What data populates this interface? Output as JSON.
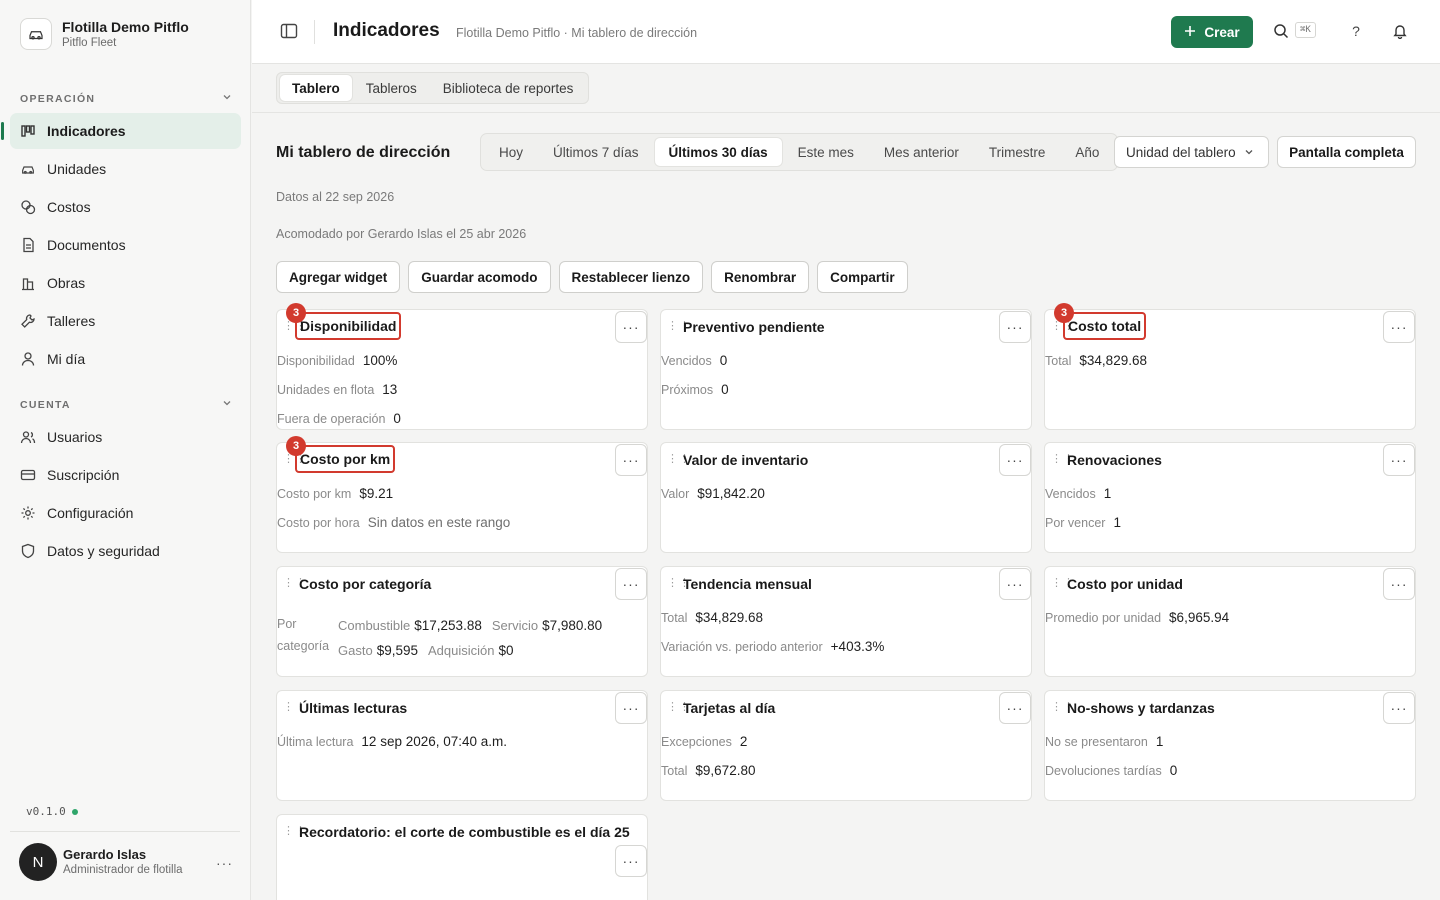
{
  "org": {
    "name": "Flotilla Demo Pitflo",
    "sub": "Pitflo Fleet"
  },
  "sidebar": {
    "section_operation": "OPERACIÓN",
    "section_account": "CUENTA",
    "items": [
      {
        "label": "Indicadores",
        "icon": "bar-chart-icon"
      },
      {
        "label": "Unidades",
        "icon": "car-icon"
      },
      {
        "label": "Costos",
        "icon": "coins-icon"
      },
      {
        "label": "Documentos",
        "icon": "document-icon"
      },
      {
        "label": "Obras",
        "icon": "building-icon"
      },
      {
        "label": "Talleres",
        "icon": "wrench-icon"
      },
      {
        "label": "Mi día",
        "icon": "person-icon"
      }
    ],
    "account_items": [
      {
        "label": "Usuarios",
        "icon": "users-icon"
      },
      {
        "label": "Suscripción",
        "icon": "credit-card-icon"
      },
      {
        "label": "Configuración",
        "icon": "gear-icon"
      },
      {
        "label": "Datos y seguridad",
        "icon": "shield-icon"
      }
    ],
    "version": "v0.1.0"
  },
  "user": {
    "initial": "N",
    "name": "Gerardo Islas",
    "role": "Administrador de flotilla",
    "more": "···"
  },
  "topbar": {
    "title": "Indicadores",
    "breadcrumb": "Flotilla Demo Pitflo · Mi tablero de dirección",
    "create_label": "Crear",
    "shortcut": "⌘K",
    "help": "?"
  },
  "tabs": [
    "Tablero",
    "Tableros",
    "Biblioteca de reportes"
  ],
  "dashboard": {
    "title": "Mi tablero de dirección",
    "ranges": [
      "Hoy",
      "Últimos 7 días",
      "Últimos 30 días",
      "Este mes",
      "Mes anterior",
      "Trimestre",
      "Año"
    ],
    "active_range": "Últimos 30 días",
    "unit_select": "Unidad del tablero",
    "fullscreen": "Pantalla completa",
    "data_as_of": "Datos al 22 sep 2026",
    "arranged_by": "Acomodado por Gerardo Islas el 25 abr 2026",
    "actions": [
      "Agregar widget",
      "Guardar acomodo",
      "Restablecer lienzo",
      "Renombrar",
      "Compartir"
    ]
  },
  "widgets": {
    "availability": {
      "title": "Disponibilidad",
      "badge": "3",
      "rows": [
        {
          "label": "Disponibilidad",
          "value": "100%"
        },
        {
          "label": "Unidades en flota",
          "value": "13"
        },
        {
          "label": "Fuera de operación",
          "value": "0"
        }
      ]
    },
    "preventive": {
      "title": "Preventivo pendiente",
      "rows": [
        {
          "label": "Vencidos",
          "value": "0"
        },
        {
          "label": "Próximos",
          "value": "0"
        }
      ]
    },
    "total_cost": {
      "title": "Costo total",
      "badge": "3",
      "rows": [
        {
          "label": "Total",
          "value": "$34,829.68"
        }
      ]
    },
    "cost_km": {
      "title": "Costo por km",
      "badge": "3",
      "rows": [
        {
          "label": "Costo por km",
          "value": "$9.21"
        },
        {
          "label": "Costo por hora",
          "value": "Sin datos en este rango"
        }
      ]
    },
    "inventory": {
      "title": "Valor de inventario",
      "rows": [
        {
          "label": "Valor",
          "value": "$91,842.20"
        }
      ]
    },
    "renewals": {
      "title": "Renovaciones",
      "rows": [
        {
          "label": "Vencidos",
          "value": "1"
        },
        {
          "label": "Por vencer",
          "value": "1"
        }
      ]
    },
    "by_category": {
      "title": "Costo por categoría",
      "label": "Por categoría",
      "items": [
        {
          "label": "Combustible",
          "value": "$17,253.88"
        },
        {
          "label": "Servicio",
          "value": "$7,980.80"
        },
        {
          "label": "Gasto",
          "value": "$9,595"
        },
        {
          "label": "Adquisición",
          "value": "$0"
        }
      ]
    },
    "trend": {
      "title": "Tendencia mensual",
      "rows": [
        {
          "label": "Total",
          "value": "$34,829.68"
        },
        {
          "label": "Variación vs. periodo anterior",
          "value": "+403.3%"
        }
      ]
    },
    "per_unit": {
      "title": "Costo por unidad",
      "rows": [
        {
          "label": "Promedio por unidad",
          "value": "$6,965.94"
        }
      ]
    },
    "readings": {
      "title": "Últimas lecturas",
      "rows": [
        {
          "label": "Última lectura",
          "value": "12 sep 2026, 07:40 a.m."
        }
      ]
    },
    "cards": {
      "title": "Tarjetas al día",
      "rows": [
        {
          "label": "Excepciones",
          "value": "2"
        },
        {
          "label": "Total",
          "value": "$9,672.80"
        }
      ]
    },
    "noshows": {
      "title": "No-shows y tardanzas",
      "rows": [
        {
          "label": "No se presentaron",
          "value": "1"
        },
        {
          "label": "Devoluciones tardías",
          "value": "0"
        }
      ]
    },
    "reminder": {
      "title": "Recordatorio: el corte de combustible es el día 25"
    },
    "menu": "···"
  },
  "colors": {
    "accent": "#1f7a4f",
    "marker": "#d23a2e"
  }
}
